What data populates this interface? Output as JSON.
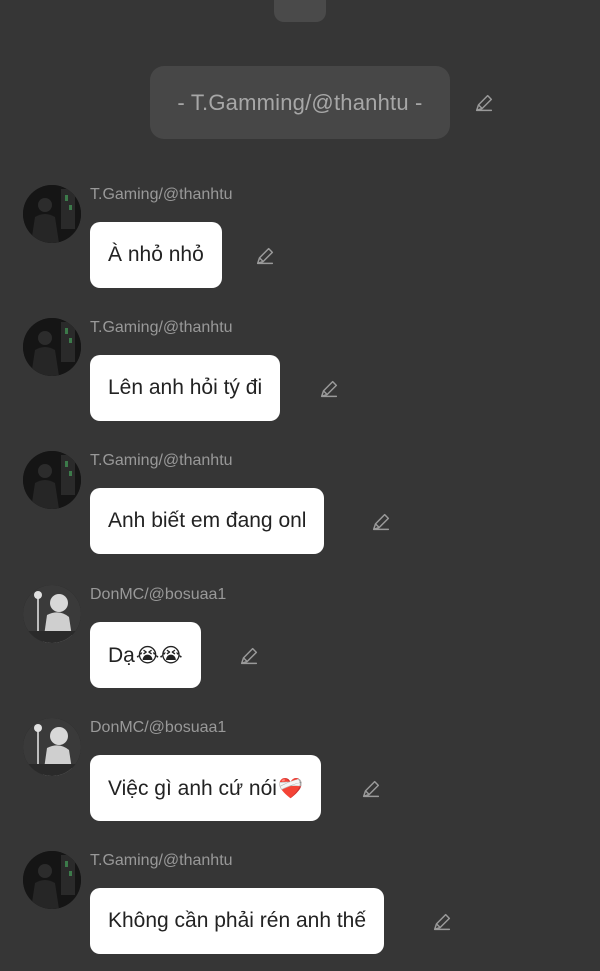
{
  "header": {
    "title": "- T.Gamming/@thanhtu -"
  },
  "messages": [
    {
      "user": "T.Gaming/@thanhtu",
      "text": "À nhỏ nhỏ",
      "emojis": "",
      "avatar": "tgaming"
    },
    {
      "user": "T.Gaming/@thanhtu",
      "text": "Lên anh hỏi tý đi",
      "emojis": "",
      "avatar": "tgaming"
    },
    {
      "user": "T.Gaming/@thanhtu",
      "text": "Anh biết em đang onl",
      "emojis": "",
      "avatar": "tgaming"
    },
    {
      "user": "DonMC/@bosuaa1",
      "text": "Dạ",
      "emojis": "😭😭",
      "avatar": "donmc"
    },
    {
      "user": "DonMC/@bosuaa1",
      "text": "Việc gì anh cứ nói",
      "emojis": "❤️‍🩹",
      "avatar": "donmc"
    },
    {
      "user": "T.Gaming/@thanhtu",
      "text": "Không cần phải rén anh thế",
      "emojis": "",
      "avatar": "tgaming"
    }
  ],
  "icons": {
    "edit": "pencil-edit-icon"
  },
  "colors": {
    "background": "#363636",
    "bubble": "#ffffff",
    "pill": "#474747"
  }
}
